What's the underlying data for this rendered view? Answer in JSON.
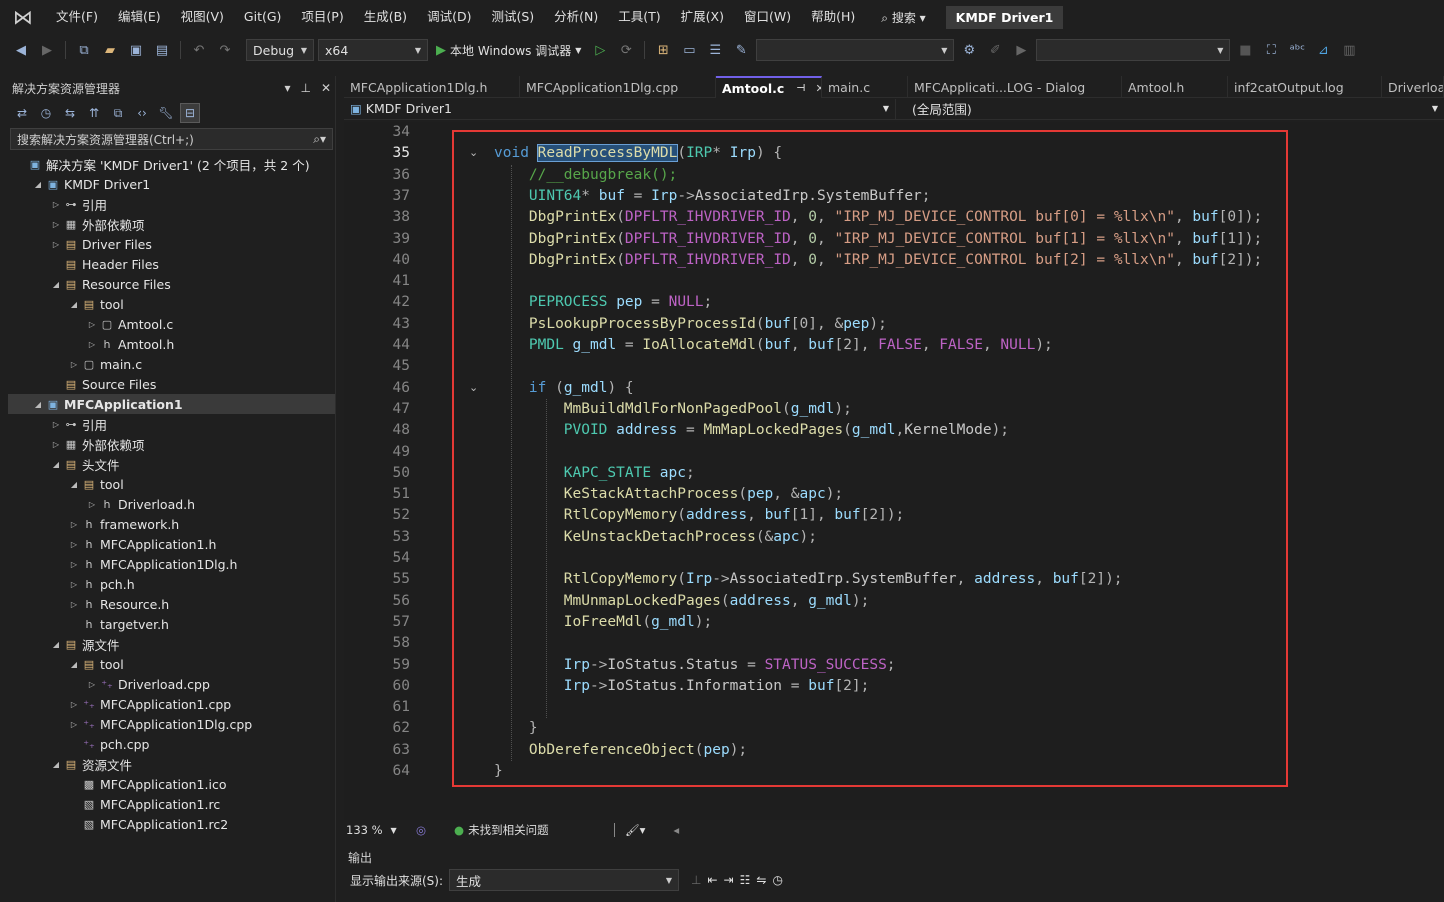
{
  "menubar": {
    "items": [
      "文件(F)",
      "编辑(E)",
      "视图(V)",
      "Git(G)",
      "项目(P)",
      "生成(B)",
      "调试(D)",
      "测试(S)",
      "分析(N)",
      "工具(T)",
      "扩展(X)",
      "窗口(W)",
      "帮助(H)"
    ],
    "search_label": "搜索",
    "solution_title": "KMDF Driver1"
  },
  "toolbar": {
    "config": "Debug",
    "platform": "x64",
    "run_label": "本地 Windows 调试器"
  },
  "solution_explorer": {
    "title": "解决方案资源管理器",
    "search_placeholder": "搜索解决方案资源管理器(Ctrl+;)",
    "tree": [
      {
        "label": "解决方案 'KMDF Driver1' (2 个项目，共 2 个)",
        "level": 0,
        "icon": "solution-icon",
        "chev": ""
      },
      {
        "label": "KMDF Driver1",
        "level": 1,
        "icon": "project-icon",
        "chev": "down"
      },
      {
        "label": "引用",
        "level": 2,
        "icon": "references-icon",
        "chev": "right"
      },
      {
        "label": "外部依赖项",
        "level": 2,
        "icon": "external-deps-icon",
        "chev": "right"
      },
      {
        "label": "Driver Files",
        "level": 2,
        "icon": "filter-folder-icon",
        "chev": "right"
      },
      {
        "label": "Header Files",
        "level": 2,
        "icon": "filter-folder-icon",
        "chev": ""
      },
      {
        "label": "Resource Files",
        "level": 2,
        "icon": "filter-folder-icon",
        "chev": "down"
      },
      {
        "label": "tool",
        "level": 3,
        "icon": "filter-folder-icon",
        "chev": "down"
      },
      {
        "label": "Amtool.c",
        "level": 4,
        "icon": "c-file-icon",
        "chev": "right"
      },
      {
        "label": "Amtool.h",
        "level": 4,
        "icon": "header-file-icon",
        "chev": "right"
      },
      {
        "label": "main.c",
        "level": 3,
        "icon": "c-file-icon",
        "chev": "right"
      },
      {
        "label": "Source Files",
        "level": 2,
        "icon": "filter-folder-icon",
        "chev": ""
      },
      {
        "label": "MFCApplication1",
        "level": 1,
        "icon": "project-icon",
        "chev": "down",
        "selected": true,
        "bold": true
      },
      {
        "label": "引用",
        "level": 2,
        "icon": "references-icon",
        "chev": "right"
      },
      {
        "label": "外部依赖项",
        "level": 2,
        "icon": "external-deps-icon",
        "chev": "right"
      },
      {
        "label": "头文件",
        "level": 2,
        "icon": "filter-folder-icon",
        "chev": "down"
      },
      {
        "label": "tool",
        "level": 3,
        "icon": "filter-folder-icon",
        "chev": "down"
      },
      {
        "label": "Driverload.h",
        "level": 4,
        "icon": "header-file-icon",
        "chev": "right"
      },
      {
        "label": "framework.h",
        "level": 3,
        "icon": "header-file-icon",
        "chev": "right"
      },
      {
        "label": "MFCApplication1.h",
        "level": 3,
        "icon": "header-file-icon",
        "chev": "right"
      },
      {
        "label": "MFCApplication1Dlg.h",
        "level": 3,
        "icon": "header-file-icon",
        "chev": "right"
      },
      {
        "label": "pch.h",
        "level": 3,
        "icon": "header-file-icon",
        "chev": "right"
      },
      {
        "label": "Resource.h",
        "level": 3,
        "icon": "header-file-icon",
        "chev": "right"
      },
      {
        "label": "targetver.h",
        "level": 3,
        "icon": "header-file-icon",
        "chev": ""
      },
      {
        "label": "源文件",
        "level": 2,
        "icon": "filter-folder-icon",
        "chev": "down"
      },
      {
        "label": "tool",
        "level": 3,
        "icon": "filter-folder-icon",
        "chev": "down"
      },
      {
        "label": "Driverload.cpp",
        "level": 4,
        "icon": "cpp-file-icon",
        "chev": "right"
      },
      {
        "label": "MFCApplication1.cpp",
        "level": 3,
        "icon": "cpp-file-icon",
        "chev": "right"
      },
      {
        "label": "MFCApplication1Dlg.cpp",
        "level": 3,
        "icon": "cpp-file-icon",
        "chev": "right"
      },
      {
        "label": "pch.cpp",
        "level": 3,
        "icon": "cpp-file-icon",
        "chev": ""
      },
      {
        "label": "资源文件",
        "level": 2,
        "icon": "filter-folder-icon",
        "chev": "down"
      },
      {
        "label": "MFCApplication1.ico",
        "level": 3,
        "icon": "ico-file-icon",
        "chev": ""
      },
      {
        "label": "MFCApplication1.rc",
        "level": 3,
        "icon": "rc-file-icon",
        "chev": ""
      },
      {
        "label": "MFCApplication1.rc2",
        "level": 3,
        "icon": "rc-file-icon",
        "chev": ""
      }
    ]
  },
  "editor": {
    "tabs": [
      {
        "label": "MFCApplication1Dlg.h",
        "w": 176
      },
      {
        "label": "MFCApplication1Dlg.cpp",
        "w": 196
      },
      {
        "label": "Amtool.c",
        "w": 106,
        "active": true
      },
      {
        "label": "main.c",
        "w": 86
      },
      {
        "label": "MFCApplicati...LOG - Dialog",
        "w": 214
      },
      {
        "label": "Amtool.h",
        "w": 106
      },
      {
        "label": "inf2catOutput.log",
        "w": 154
      },
      {
        "label": "Driverloa",
        "w": 62
      }
    ],
    "nav_project": "KMDF Driver1",
    "nav_scope": "(全局范围)",
    "zoom": "133 %",
    "status_text": "未找到相关问题",
    "first_line": 34,
    "current_line": 35,
    "lines": [
      [],
      [
        [
          "kw",
          "void "
        ],
        [
          "fn hl",
          "ReadProcessByMDL"
        ],
        [
          "pu",
          "("
        ],
        [
          "ty",
          "IRP"
        ],
        [
          "pu",
          "* "
        ],
        [
          "var",
          "Irp"
        ],
        [
          "pu",
          ") {"
        ]
      ],
      [
        [
          "cm",
          "//__debugbreak();"
        ]
      ],
      [
        [
          "ty",
          "UINT64"
        ],
        [
          "pu",
          "* "
        ],
        [
          "var",
          "buf"
        ],
        [
          "pu",
          " = "
        ],
        [
          "var",
          "Irp"
        ],
        [
          "pu",
          "->"
        ],
        [
          "glob",
          "AssociatedIrp.SystemBuffer"
        ],
        [
          "pu",
          ";"
        ]
      ],
      [
        [
          "fn",
          "DbgPrintEx"
        ],
        [
          "pu",
          "("
        ],
        [
          "mac",
          "DPFLTR_IHVDRIVER_ID"
        ],
        [
          "pu",
          ", "
        ],
        [
          "num",
          "0"
        ],
        [
          "pu",
          ", "
        ],
        [
          "str",
          "\"IRP_MJ_DEVICE_CONTROL buf[0] = %llx\\n\""
        ],
        [
          "pu",
          ", "
        ],
        [
          "var",
          "buf"
        ],
        [
          "pu",
          "[0]);"
        ]
      ],
      [
        [
          "fn",
          "DbgPrintEx"
        ],
        [
          "pu",
          "("
        ],
        [
          "mac",
          "DPFLTR_IHVDRIVER_ID"
        ],
        [
          "pu",
          ", "
        ],
        [
          "num",
          "0"
        ],
        [
          "pu",
          ", "
        ],
        [
          "str",
          "\"IRP_MJ_DEVICE_CONTROL buf[1] = %llx\\n\""
        ],
        [
          "pu",
          ", "
        ],
        [
          "var",
          "buf"
        ],
        [
          "pu",
          "[1]);"
        ]
      ],
      [
        [
          "fn",
          "DbgPrintEx"
        ],
        [
          "pu",
          "("
        ],
        [
          "mac",
          "DPFLTR_IHVDRIVER_ID"
        ],
        [
          "pu",
          ", "
        ],
        [
          "num",
          "0"
        ],
        [
          "pu",
          ", "
        ],
        [
          "str",
          "\"IRP_MJ_DEVICE_CONTROL buf[2] = %llx\\n\""
        ],
        [
          "pu",
          ", "
        ],
        [
          "var",
          "buf"
        ],
        [
          "pu",
          "[2]);"
        ]
      ],
      [],
      [
        [
          "ty",
          "PEPROCESS "
        ],
        [
          "var",
          "pep"
        ],
        [
          "pu",
          " = "
        ],
        [
          "mac",
          "NULL"
        ],
        [
          "pu",
          ";"
        ]
      ],
      [
        [
          "fn",
          "PsLookupProcessByProcessId"
        ],
        [
          "pu",
          "("
        ],
        [
          "var",
          "buf"
        ],
        [
          "pu",
          "[0], &"
        ],
        [
          "var",
          "pep"
        ],
        [
          "pu",
          ");"
        ]
      ],
      [
        [
          "ty",
          "PMDL "
        ],
        [
          "var",
          "g_mdl"
        ],
        [
          "pu",
          " = "
        ],
        [
          "fn",
          "IoAllocateMdl"
        ],
        [
          "pu",
          "("
        ],
        [
          "var",
          "buf"
        ],
        [
          "pu",
          ", "
        ],
        [
          "var",
          "buf"
        ],
        [
          "pu",
          "[2], "
        ],
        [
          "mac",
          "FALSE"
        ],
        [
          "pu",
          ", "
        ],
        [
          "mac",
          "FALSE"
        ],
        [
          "pu",
          ", "
        ],
        [
          "mac",
          "NULL"
        ],
        [
          "pu",
          ");"
        ]
      ],
      [],
      [
        [
          "kw",
          "if "
        ],
        [
          "pu",
          "("
        ],
        [
          "var",
          "g_mdl"
        ],
        [
          "pu",
          ") {"
        ]
      ],
      [
        [
          "fn",
          "MmBuildMdlForNonPagedPool"
        ],
        [
          "pu",
          "("
        ],
        [
          "var",
          "g_mdl"
        ],
        [
          "pu",
          ");"
        ]
      ],
      [
        [
          "ty",
          "PVOID "
        ],
        [
          "var",
          "address"
        ],
        [
          "pu",
          " = "
        ],
        [
          "fn",
          "MmMapLockedPages"
        ],
        [
          "pu",
          "("
        ],
        [
          "var",
          "g_mdl"
        ],
        [
          "pu",
          ","
        ],
        [
          "glob",
          "KernelMode"
        ],
        [
          "pu",
          ");"
        ]
      ],
      [],
      [
        [
          "ty",
          "KAPC_STATE "
        ],
        [
          "var",
          "apc"
        ],
        [
          "pu",
          ";"
        ]
      ],
      [
        [
          "fn",
          "KeStackAttachProcess"
        ],
        [
          "pu",
          "("
        ],
        [
          "var",
          "pep"
        ],
        [
          "pu",
          ", &"
        ],
        [
          "var",
          "apc"
        ],
        [
          "pu",
          ");"
        ]
      ],
      [
        [
          "fn",
          "RtlCopyMemory"
        ],
        [
          "pu",
          "("
        ],
        [
          "var",
          "address"
        ],
        [
          "pu",
          ", "
        ],
        [
          "var",
          "buf"
        ],
        [
          "pu",
          "[1], "
        ],
        [
          "var",
          "buf"
        ],
        [
          "pu",
          "[2]);"
        ]
      ],
      [
        [
          "fn",
          "KeUnstackDetachProcess"
        ],
        [
          "pu",
          "(&"
        ],
        [
          "var",
          "apc"
        ],
        [
          "pu",
          ");"
        ]
      ],
      [],
      [
        [
          "fn",
          "RtlCopyMemory"
        ],
        [
          "pu",
          "("
        ],
        [
          "var",
          "Irp"
        ],
        [
          "pu",
          "->"
        ],
        [
          "glob",
          "AssociatedIrp.SystemBuffer"
        ],
        [
          "pu",
          ", "
        ],
        [
          "var",
          "address"
        ],
        [
          "pu",
          ", "
        ],
        [
          "var",
          "buf"
        ],
        [
          "pu",
          "[2]);"
        ]
      ],
      [
        [
          "fn",
          "MmUnmapLockedPages"
        ],
        [
          "pu",
          "("
        ],
        [
          "var",
          "address"
        ],
        [
          "pu",
          ", "
        ],
        [
          "var",
          "g_mdl"
        ],
        [
          "pu",
          ");"
        ]
      ],
      [
        [
          "fn",
          "IoFreeMdl"
        ],
        [
          "pu",
          "("
        ],
        [
          "var",
          "g_mdl"
        ],
        [
          "pu",
          ");"
        ]
      ],
      [],
      [
        [
          "var",
          "Irp"
        ],
        [
          "pu",
          "->"
        ],
        [
          "glob",
          "IoStatus.Status"
        ],
        [
          "pu",
          " = "
        ],
        [
          "mac",
          "STATUS_SUCCESS"
        ],
        [
          "pu",
          ";"
        ]
      ],
      [
        [
          "var",
          "Irp"
        ],
        [
          "pu",
          "->"
        ],
        [
          "glob",
          "IoStatus.Information"
        ],
        [
          "pu",
          " = "
        ],
        [
          "var",
          "buf"
        ],
        [
          "pu",
          "[2];"
        ]
      ],
      [],
      [
        [
          "pu",
          "}"
        ]
      ],
      [
        [
          "fn",
          "ObDereferenceObject"
        ],
        [
          "pu",
          "("
        ],
        [
          "var",
          "pep"
        ],
        [
          "pu",
          ");"
        ]
      ],
      [
        [
          "pu",
          "}"
        ]
      ]
    ]
  },
  "output": {
    "title": "输出",
    "source_label": "显示输出来源(S):",
    "source_value": "生成"
  }
}
